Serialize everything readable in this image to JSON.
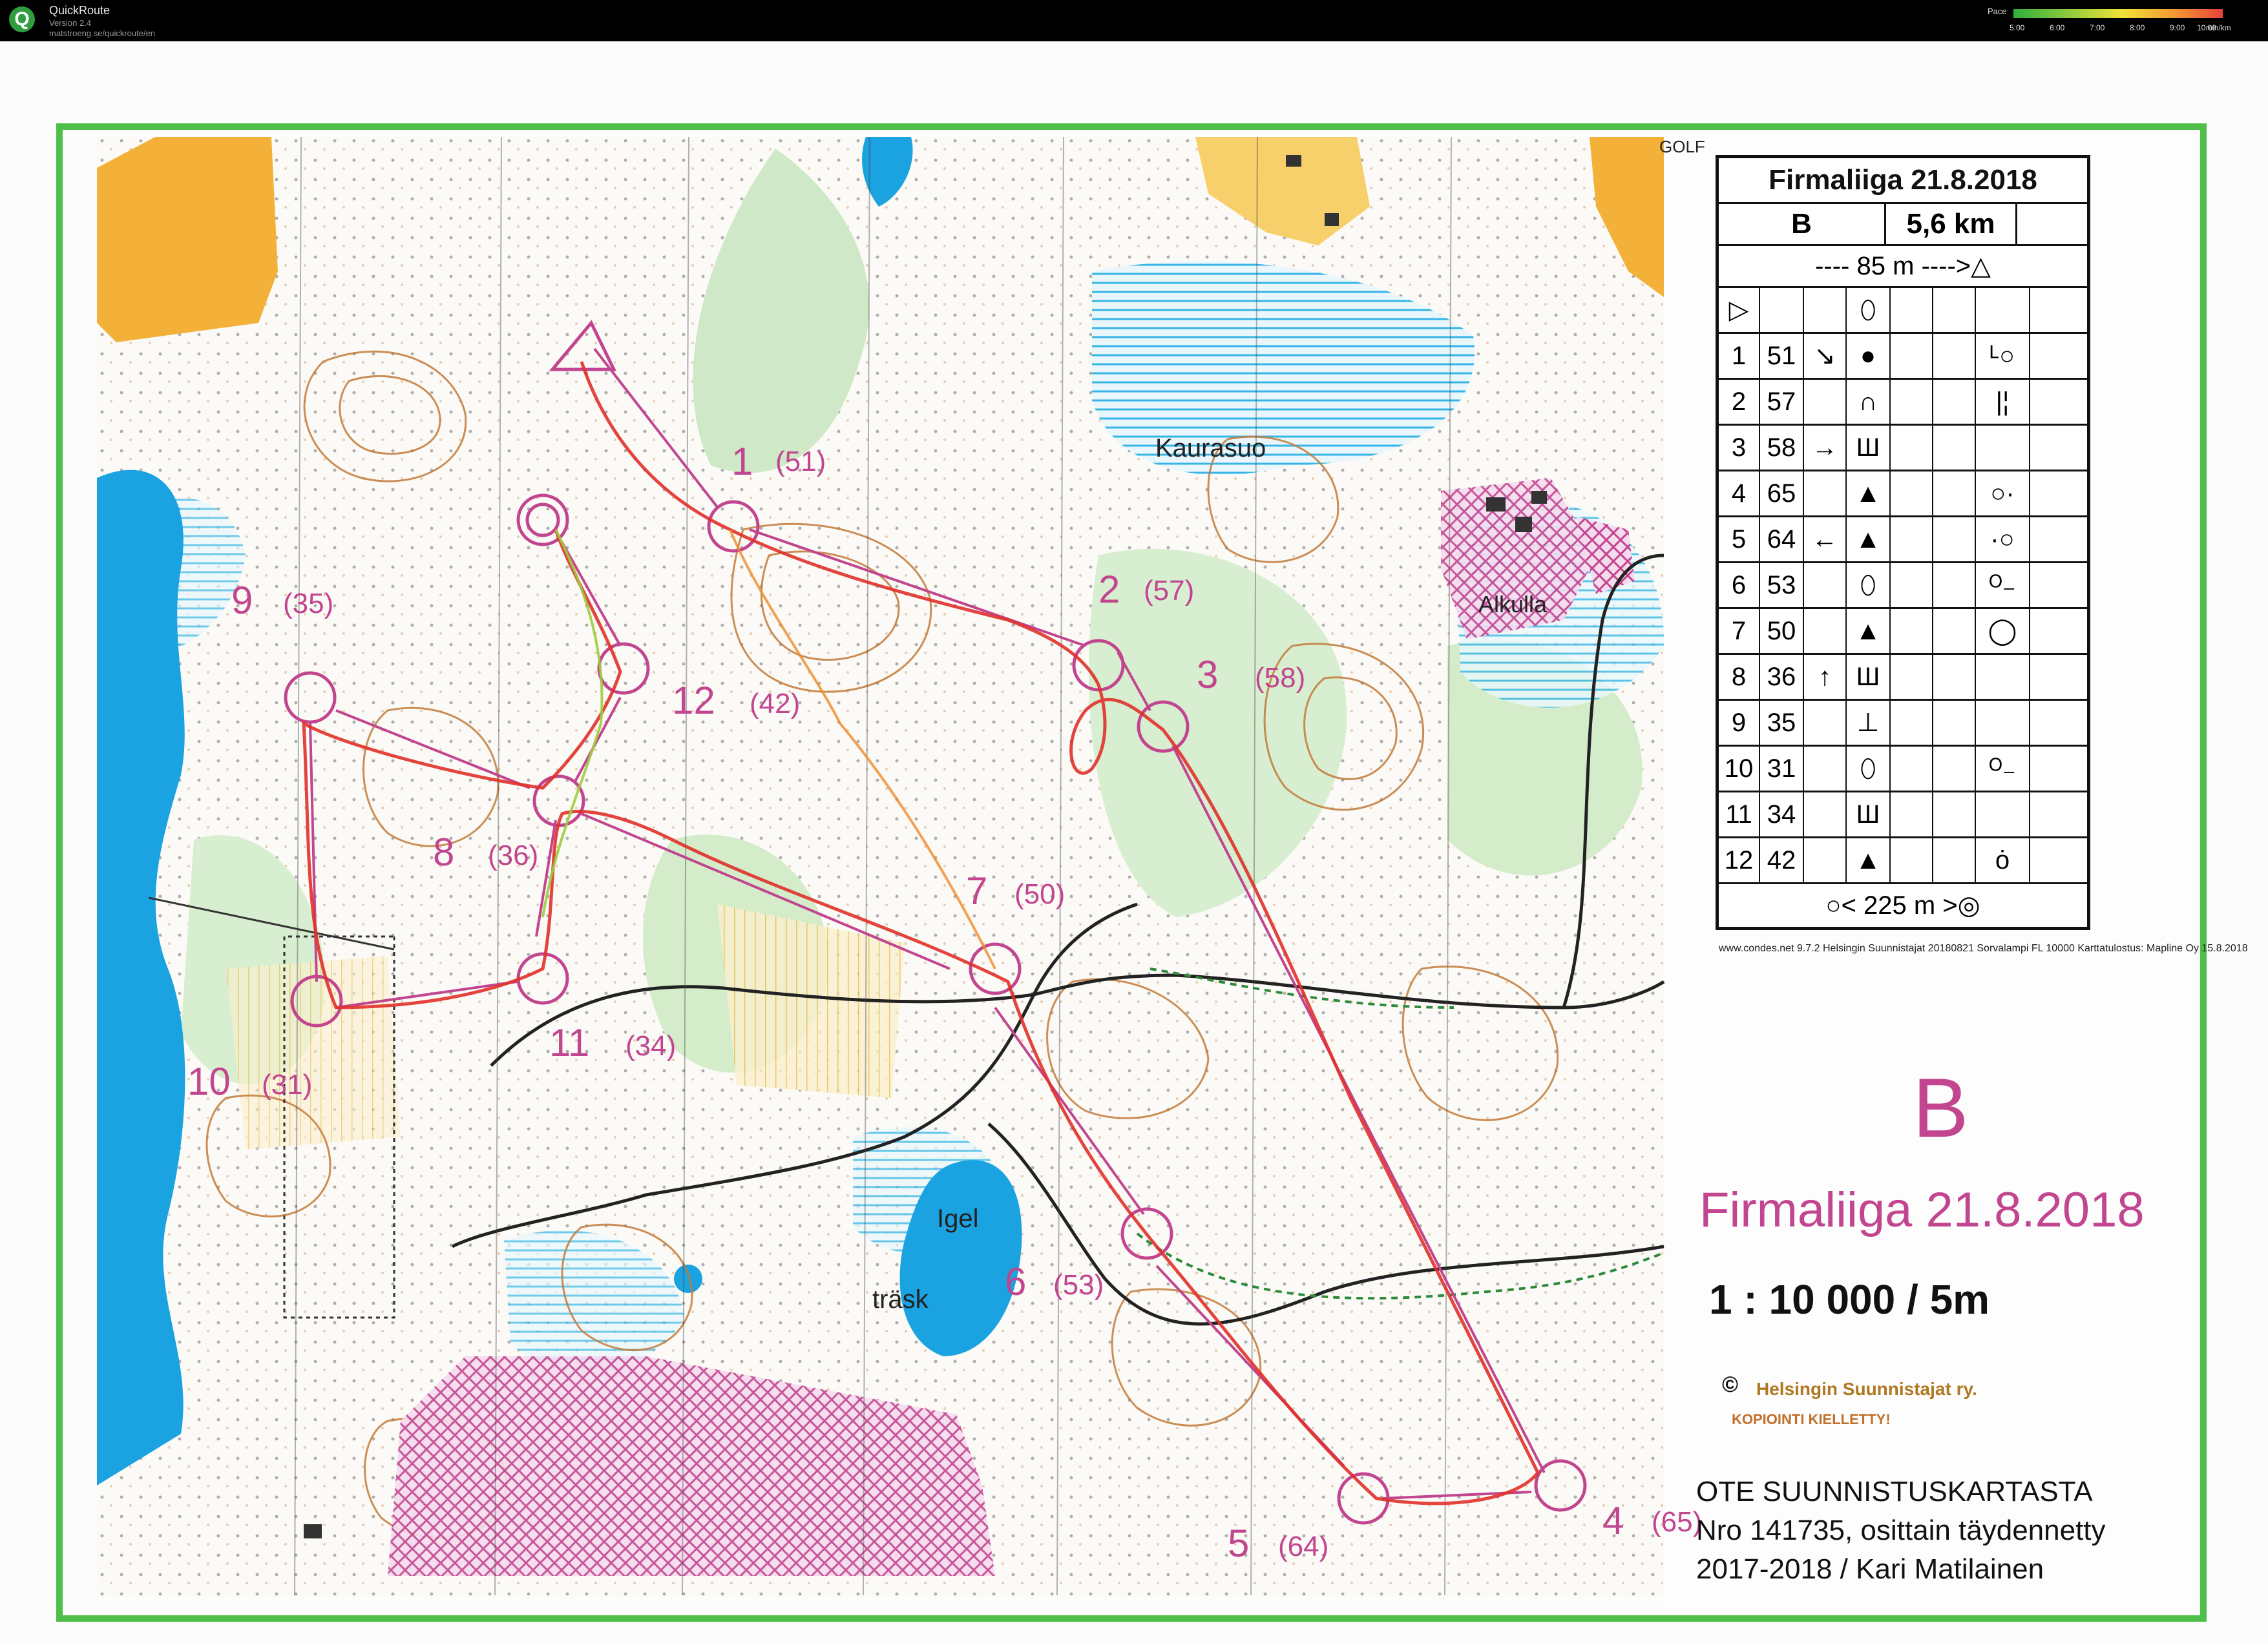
{
  "window": {
    "app_name": "QuickRoute",
    "version": "Version 2.4",
    "url": "matstroeng.se/quickroute/en",
    "icon": "quickroute-logo-icon"
  },
  "pace_legend": {
    "label": "Pace",
    "ticks": [
      "5:00",
      "6:00",
      "7:00",
      "8:00",
      "9:00",
      "10:00"
    ],
    "unit": "min/km",
    "colors": [
      "#2fae3a",
      "#93cc3c",
      "#f1e23a",
      "#f29b33",
      "#e8413a"
    ]
  },
  "map": {
    "course_letter": "B",
    "event_title": "Firmaliiga 21.8.2018",
    "scale": "1 : 10 000  / 5m",
    "copyright_symbol": "©",
    "club": "Helsingin Suunnistajat ry.",
    "copy_warning": "KOPIOINTI KIELLETTY!",
    "info_lines": [
      "OTE SUUNNISTUSKARTASTA",
      "Nro  141735, osittain täydennetty",
      "2017-2018 / Kari Matilainen"
    ],
    "place_labels": {
      "kaurasuo": "Kaurasuo",
      "alkulla": "Alkulla",
      "igel": "Igel",
      "trask": "träsk",
      "golf": "GOLF"
    },
    "colors": {
      "course": "#c2458f",
      "water": "#1aa3e0",
      "route": "#e0302a",
      "frame": "#4fbf4a",
      "contour": "#c27a3a",
      "open_land": "#f3b13a"
    }
  },
  "controls": [
    {
      "num": "1",
      "code": "(51)"
    },
    {
      "num": "2",
      "code": "(57)"
    },
    {
      "num": "3",
      "code": "(58)"
    },
    {
      "num": "4",
      "code": "(65)"
    },
    {
      "num": "5",
      "code": "(64)"
    },
    {
      "num": "6",
      "code": "(53)"
    },
    {
      "num": "7",
      "code": "(50)"
    },
    {
      "num": "8",
      "code": "(36)"
    },
    {
      "num": "9",
      "code": "(35)"
    },
    {
      "num": "10",
      "code": "(31)"
    },
    {
      "num": "11",
      "code": "(34)"
    },
    {
      "num": "12",
      "code": "(42)"
    }
  ],
  "description_sheet": {
    "title": "Firmaliiga 21.8.2018",
    "class": "B",
    "length": "5,6 km",
    "start_line": "---- 85 m ---->△",
    "start_symbol": "▷",
    "start_feature": "⬯",
    "rows": [
      {
        "no": "1",
        "code": "51",
        "dir": "↘",
        "feature": "●",
        "extra": "ᴸ○"
      },
      {
        "no": "2",
        "code": "57",
        "dir": "",
        "feature": "∩",
        "extra": "|¦"
      },
      {
        "no": "3",
        "code": "58",
        "dir": "→",
        "feature": "Ш",
        "extra": ""
      },
      {
        "no": "4",
        "code": "65",
        "dir": "",
        "feature": "▲",
        "extra": "○·"
      },
      {
        "no": "5",
        "code": "64",
        "dir": "←",
        "feature": "▲",
        "extra": "·○"
      },
      {
        "no": "6",
        "code": "53",
        "dir": "",
        "feature": "⬯",
        "extra": "ᴼ₋"
      },
      {
        "no": "7",
        "code": "50",
        "dir": "",
        "feature": "▲",
        "extra": "◯"
      },
      {
        "no": "8",
        "code": "36",
        "dir": "↑",
        "feature": "Ш",
        "extra": ""
      },
      {
        "no": "9",
        "code": "35",
        "dir": "",
        "feature": "⊥",
        "extra": ""
      },
      {
        "no": "10",
        "code": "31",
        "dir": "",
        "feature": "⬯",
        "extra": "ᴼ₋"
      },
      {
        "no": "11",
        "code": "34",
        "dir": "",
        "feature": "Ш",
        "extra": ""
      },
      {
        "no": "12",
        "code": "42",
        "dir": "",
        "feature": "▲",
        "extra": "ȯ"
      }
    ],
    "finish_line": "○<   225 m   >◎",
    "footer": "www.condes.net 9.7.2 Helsingin Suunnistajat    20180821 Sorvalampi FL 10000    Karttatulostus: Mapline Oy 15.8.2018"
  }
}
